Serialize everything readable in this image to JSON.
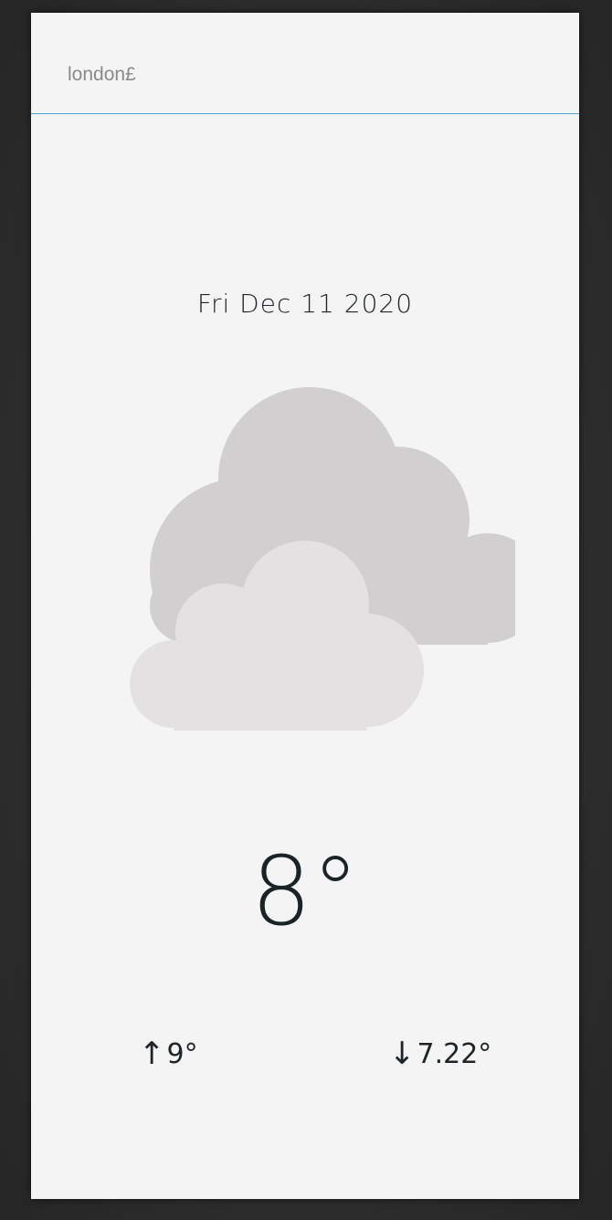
{
  "search": {
    "value": "london£",
    "placeholder": ""
  },
  "weather": {
    "date": "Fri Dec 11 2020",
    "condition_icon": "cloudy-icon",
    "temperature": "8°",
    "max_arrow": "↑",
    "max_temp": "9°",
    "min_arrow": "↓",
    "min_temp": "7.22°"
  },
  "colors": {
    "background": "#f4f4f4",
    "accent_underline": "#4aa3d3",
    "text": "#1d2528",
    "cloud_back": "#d1cfd0",
    "cloud_front": "#e3e1e2"
  }
}
